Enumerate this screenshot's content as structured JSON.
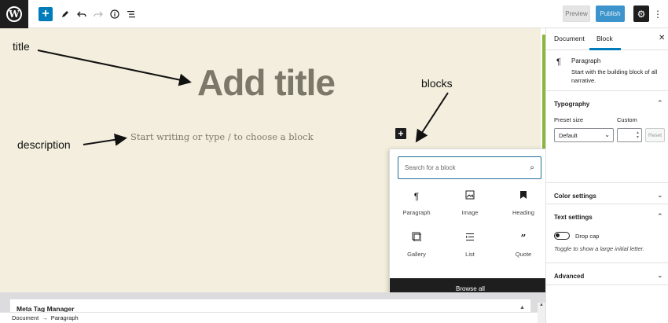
{
  "toolbar": {
    "add_icon": "plus-icon",
    "preview_label": "Preview",
    "publish_label": "Publish"
  },
  "canvas": {
    "title_placeholder": "Add title",
    "paragraph_placeholder": "Start writing or type / to choose a block"
  },
  "annotations": {
    "title": "title",
    "description": "description",
    "blocks": "blocks"
  },
  "inserter": {
    "search_placeholder": "Search for a block",
    "blocks": [
      {
        "label": "Paragraph",
        "icon": "paragraph-icon"
      },
      {
        "label": "Image",
        "icon": "image-icon"
      },
      {
        "label": "Heading",
        "icon": "heading-icon"
      },
      {
        "label": "Gallery",
        "icon": "gallery-icon"
      },
      {
        "label": "List",
        "icon": "list-icon"
      },
      {
        "label": "Quote",
        "icon": "quote-icon"
      }
    ],
    "browse_all": "Browse all"
  },
  "metabox": {
    "title": "Meta Tag Manager"
  },
  "breadcrumb": {
    "root": "Document",
    "separator": "→",
    "current": "Paragraph"
  },
  "sidebar": {
    "tabs": [
      "Document",
      "Block"
    ],
    "active_tab": "Block",
    "block_card": {
      "title": "Paragraph",
      "description": "Start with the building block of all narrative."
    },
    "typography": {
      "title": "Typography",
      "preset_label": "Preset size",
      "custom_label": "Custom",
      "preset_value": "Default",
      "reset_label": "Reset"
    },
    "color_settings": "Color settings",
    "text_settings": {
      "title": "Text settings",
      "drop_cap_label": "Drop cap",
      "drop_cap_help": "Toggle to show a large initial letter.",
      "drop_cap_enabled": false
    },
    "advanced": "Advanced"
  },
  "colors": {
    "accent": "#007cba",
    "canvas_bg": "#f3eedd",
    "dark": "#1e1e1e"
  }
}
